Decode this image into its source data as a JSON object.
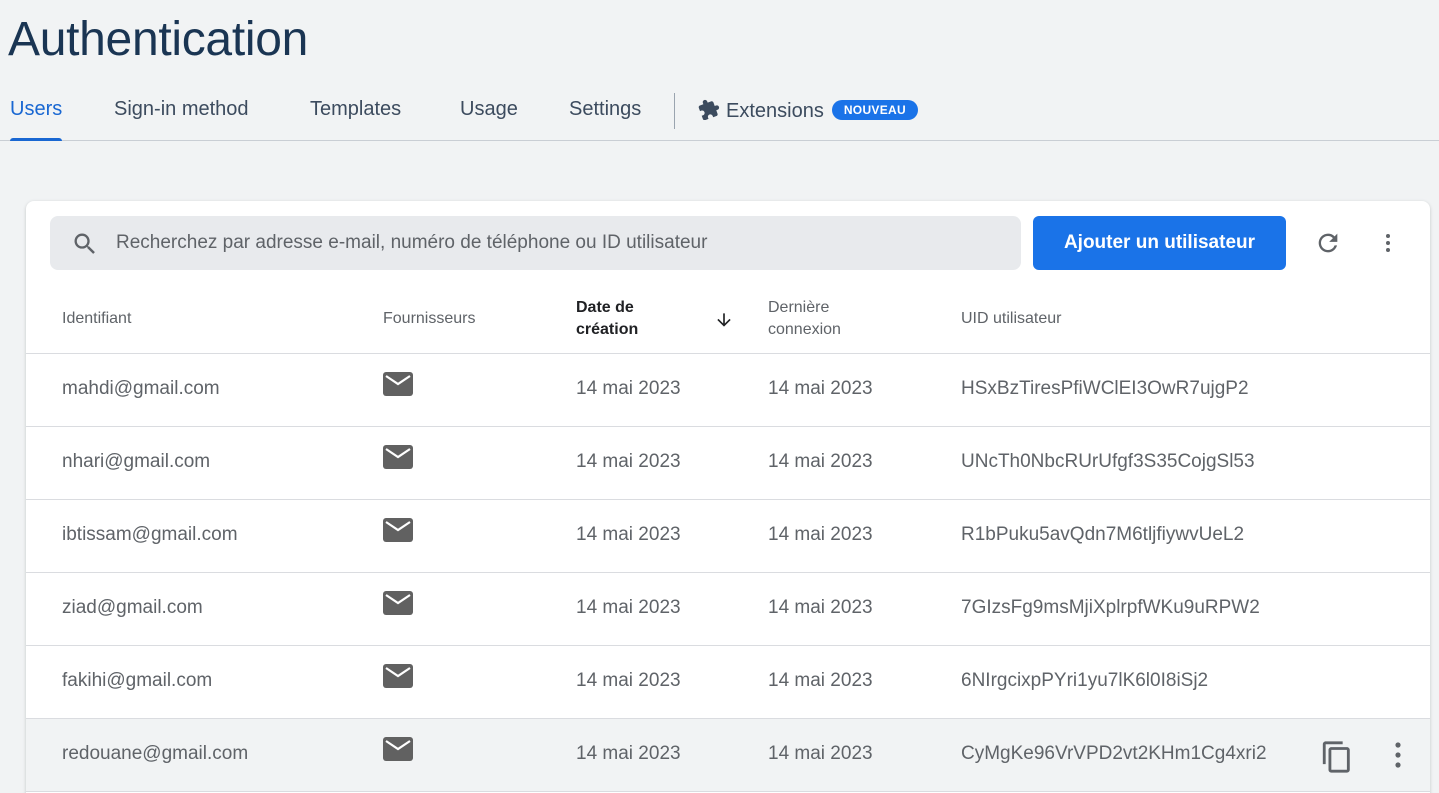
{
  "page": {
    "title": "Authentication"
  },
  "tabs": [
    {
      "label": "Users",
      "active": true
    },
    {
      "label": "Sign-in method",
      "active": false
    },
    {
      "label": "Templates",
      "active": false
    },
    {
      "label": "Usage",
      "active": false
    },
    {
      "label": "Settings",
      "active": false
    },
    {
      "label": "Extensions",
      "active": false,
      "badge": "NOUVEAU",
      "icon": "puzzle-icon"
    }
  ],
  "toolbar": {
    "search_placeholder": "Recherchez par adresse e-mail, numéro de téléphone ou ID utilisateur",
    "search_value": "",
    "add_user_label": "Ajouter un utilisateur"
  },
  "table": {
    "columns": [
      {
        "label": "Identifiant"
      },
      {
        "label": "Fournisseurs"
      },
      {
        "label_line1": "Date de",
        "label_line2": "création",
        "sorted": "desc"
      },
      {
        "label_line1": "Dernière",
        "label_line2": "connexion"
      },
      {
        "label": "UID utilisateur"
      }
    ],
    "rows": [
      {
        "identifier": "mahdi@gmail.com",
        "provider": "email",
        "created": "14 mai 2023",
        "last_signin": "14 mai 2023",
        "uid": "HSxBzTiresPfiWClEI3OwR7ujgP2"
      },
      {
        "identifier": "nhari@gmail.com",
        "provider": "email",
        "created": "14 mai 2023",
        "last_signin": "14 mai 2023",
        "uid": "UNcTh0NbcRUrUfgf3S35CojgSl53"
      },
      {
        "identifier": "ibtissam@gmail.com",
        "provider": "email",
        "created": "14 mai 2023",
        "last_signin": "14 mai 2023",
        "uid": "R1bPuku5avQdn7M6tljfiywvUeL2"
      },
      {
        "identifier": "ziad@gmail.com",
        "provider": "email",
        "created": "14 mai 2023",
        "last_signin": "14 mai 2023",
        "uid": "7GIzsFg9msMjiXplrpfWKu9uRPW2"
      },
      {
        "identifier": "fakihi@gmail.com",
        "provider": "email",
        "created": "14 mai 2023",
        "last_signin": "14 mai 2023",
        "uid": "6NIrgcixpPYri1yu7lK6l0I8iSj2"
      },
      {
        "identifier": "redouane@gmail.com",
        "provider": "email",
        "created": "14 mai 2023",
        "last_signin": "14 mai 2023",
        "uid": "CyMgKe96VrVPD2vt2KHm1Cg4xri2",
        "hovered": true
      }
    ]
  },
  "colors": {
    "accent": "#1a73e8",
    "title": "#1a3553",
    "background": "#f1f3f4"
  }
}
